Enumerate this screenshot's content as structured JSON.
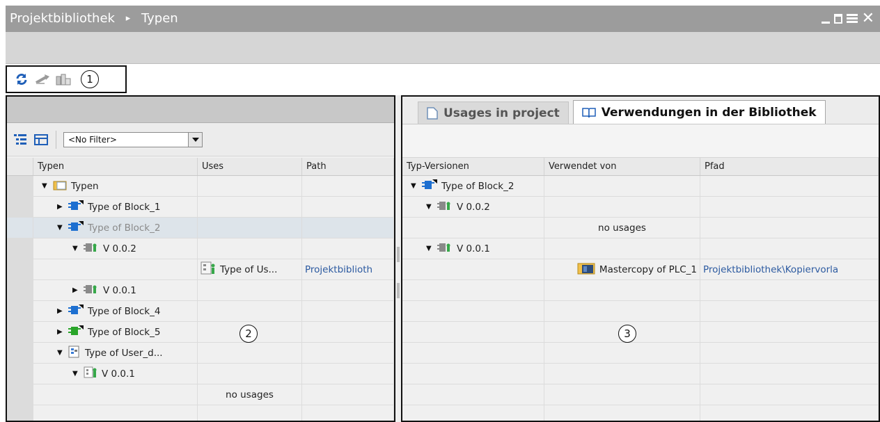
{
  "window": {
    "breadcrumb": [
      "Projektbibliothek",
      "Typen"
    ],
    "separator": "▸",
    "controls": [
      "minimize-icon",
      "float-icon",
      "maximize-icon",
      "close-icon"
    ]
  },
  "toolbar": {
    "icons": [
      "refresh-icon",
      "jump-icon",
      "copy-to-library-icon"
    ],
    "callout": "1"
  },
  "left_panel": {
    "filter": {
      "value": "<No Filter>"
    },
    "columns": [
      "Typen",
      "Uses",
      "Path"
    ],
    "rows": [
      {
        "label": "Typen",
        "uses": "",
        "path": "",
        "expanded": "▼"
      },
      {
        "label": "Type of Block_1",
        "uses": "",
        "path": "",
        "expanded": "▶"
      },
      {
        "label": "Type of Block_2",
        "uses": "",
        "path": "",
        "expanded": "▼"
      },
      {
        "label": "V 0.0.2",
        "uses": "",
        "path": "",
        "expanded": "▼"
      },
      {
        "label": "",
        "uses": "Type of Us...",
        "path": "Projektbiblioth",
        "expanded": ""
      },
      {
        "label": "V 0.0.1",
        "uses": "",
        "path": "",
        "expanded": "▶"
      },
      {
        "label": "Type of Block_4",
        "uses": "",
        "path": "",
        "expanded": "▶"
      },
      {
        "label": "Type of Block_5",
        "uses": "",
        "path": "",
        "expanded": "▶"
      },
      {
        "label": "Type of User_d...",
        "uses": "",
        "path": "",
        "expanded": "▼"
      },
      {
        "label": "V 0.0.1",
        "uses": "",
        "path": "",
        "expanded": "▼"
      },
      {
        "label": "",
        "uses": "no usages",
        "path": "",
        "expanded": ""
      },
      {
        "label": "",
        "uses": "",
        "path": "",
        "expanded": ""
      }
    ],
    "callout": "2"
  },
  "right_panel": {
    "tabs": [
      {
        "label": "Usages in project",
        "active": false
      },
      {
        "label": "Verwendungen in der Bibliothek",
        "active": true
      }
    ],
    "columns": [
      "Typ-Versionen",
      "Verwendet von",
      "Pfad"
    ],
    "rows": [
      {
        "label": "Type of Block_2",
        "used_by": "",
        "path": "",
        "expanded": "▼"
      },
      {
        "label": "V 0.0.2",
        "used_by": "",
        "path": "",
        "expanded": "▼"
      },
      {
        "label": "",
        "used_by": "no usages",
        "path": "",
        "expanded": ""
      },
      {
        "label": "V 0.0.1",
        "used_by": "",
        "path": "",
        "expanded": "▼"
      },
      {
        "label": "",
        "used_by": "Mastercopy of PLC_1",
        "path": "Projektbibliothek\\Kopiervorla",
        "expanded": ""
      },
      {
        "label": "",
        "used_by": "",
        "path": "",
        "expanded": ""
      },
      {
        "label": "",
        "used_by": "",
        "path": "",
        "expanded": ""
      },
      {
        "label": "",
        "used_by": "",
        "path": "",
        "expanded": ""
      },
      {
        "label": "",
        "used_by": "",
        "path": "",
        "expanded": ""
      },
      {
        "label": "",
        "used_by": "",
        "path": "",
        "expanded": ""
      },
      {
        "label": "",
        "used_by": "",
        "path": "",
        "expanded": ""
      },
      {
        "label": "",
        "used_by": "",
        "path": "",
        "expanded": ""
      }
    ],
    "callout": "3"
  },
  "colors": {
    "titlebar": "#9c9c9c",
    "link": "#2c5aa0",
    "block_icon_blue": "#1d6fd0",
    "block_icon_green": "#2aa52a",
    "version_icon": "#8a8a8a"
  }
}
